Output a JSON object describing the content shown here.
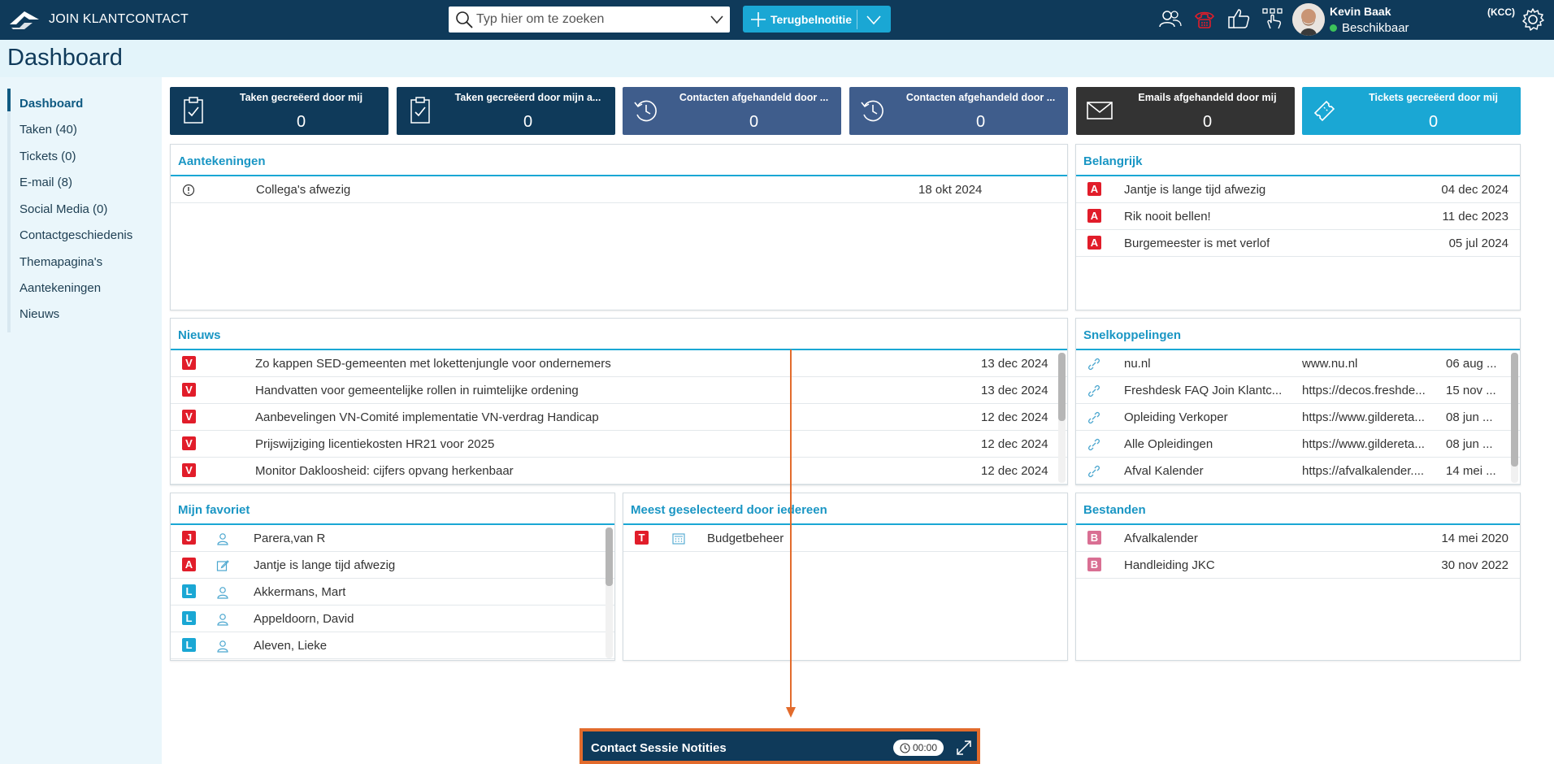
{
  "header": {
    "logo_text": "JOIN KLANTCONTACT",
    "search_placeholder": "Typ hier om te zoeken",
    "note_button": "Terugbelnotitie",
    "user_name": "Kevin Baak",
    "user_status": "Beschikbaar",
    "user_badge": "(KCC)",
    "icons": [
      "contacts-icon",
      "phone-icon",
      "thumbs-up-icon",
      "touch-icon"
    ],
    "colors": {
      "bar": "#0f3a5a",
      "accent": "#1aa7d4",
      "status_ok": "#3cc35a",
      "phone_red": "#e11d2a"
    }
  },
  "page": {
    "title": "Dashboard"
  },
  "sidebar": {
    "items": [
      {
        "label": "Dashboard",
        "active": true
      },
      {
        "label": "Taken (40)"
      },
      {
        "label": "Tickets (0)"
      },
      {
        "label": "E-mail (8)"
      },
      {
        "label": "Social Media (0)"
      },
      {
        "label": "Contactgeschiedenis"
      },
      {
        "label": "Themapagina's"
      },
      {
        "label": "Aantekeningen"
      },
      {
        "label": "Nieuws"
      }
    ]
  },
  "tiles": [
    {
      "label": "Taken gecreëerd door mij",
      "value": "0",
      "icon": "clipboard-check-icon",
      "color": "#0f3a5a"
    },
    {
      "label": "Taken gecreëerd door mijn a...",
      "value": "0",
      "icon": "clipboard-check-icon",
      "color": "#0f3a5a"
    },
    {
      "label": "Contacten afgehandeld door ...",
      "value": "0",
      "icon": "history-icon",
      "color": "#3f5d8c"
    },
    {
      "label": "Contacten afgehandeld door ...",
      "value": "0",
      "icon": "history-icon",
      "color": "#3f5d8c"
    },
    {
      "label": "Emails afgehandeld door mij",
      "value": "0",
      "icon": "envelope-icon",
      "color": "#333333"
    },
    {
      "label": "Tickets gecreëerd door mij",
      "value": "0",
      "icon": "ticket-icon",
      "color": "#1aa7d4"
    }
  ],
  "aantekeningen": {
    "title": "Aantekeningen",
    "rows": [
      {
        "icon": "info-icon",
        "text": "Collega's afwezig",
        "date": "18 okt 2024"
      }
    ]
  },
  "belangrijk": {
    "title": "Belangrijk",
    "rows": [
      {
        "badge": "A",
        "text": "Jantje is lange tijd afwezig",
        "date": "04 dec 2024"
      },
      {
        "badge": "A",
        "text": "Rik nooit bellen!",
        "date": "11 dec 2023"
      },
      {
        "badge": "A",
        "text": "Burgemeester is met verlof",
        "date": "05 jul 2024"
      }
    ]
  },
  "nieuws": {
    "title": "Nieuws",
    "rows": [
      {
        "badge": "V",
        "text": "Zo kappen SED-gemeenten met lokettenjungle voor ondernemers",
        "date": "13 dec 2024"
      },
      {
        "badge": "V",
        "text": "Handvatten voor gemeentelijke rollen in ruimtelijke ordening",
        "date": "13 dec 2024"
      },
      {
        "badge": "V",
        "text": "Aanbevelingen VN-Comité implementatie VN-verdrag Handicap",
        "date": "12 dec 2024"
      },
      {
        "badge": "V",
        "text": "Prijswijziging licentiekosten HR21 voor 2025",
        "date": "12 dec 2024"
      },
      {
        "badge": "V",
        "text": "Monitor Dakloosheid: cijfers opvang herkenbaar",
        "date": "12 dec 2024"
      }
    ]
  },
  "snelkoppelingen": {
    "title": "Snelkoppelingen",
    "rows": [
      {
        "name": "nu.nl",
        "url": "www.nu.nl",
        "date": "06 aug ..."
      },
      {
        "name": "Freshdesk FAQ Join Klantc...",
        "url": "https://decos.freshde...",
        "date": "15 nov ..."
      },
      {
        "name": "Opleiding Verkoper",
        "url": "https://www.gildereta...",
        "date": "08 jun ..."
      },
      {
        "name": "Alle Opleidingen",
        "url": "https://www.gildereta...",
        "date": "08 jun ..."
      },
      {
        "name": "Afval Kalender",
        "url": "https://afvalkalender....",
        "date": "14 mei ..."
      }
    ]
  },
  "favoriet": {
    "title": "Mijn favoriet",
    "rows": [
      {
        "badge": "J",
        "badge_color": "red",
        "icon": "person-icon",
        "text": "Parera,van R"
      },
      {
        "badge": "A",
        "badge_color": "red",
        "icon": "edit-note-icon",
        "text": "Jantje is lange tijd afwezig"
      },
      {
        "badge": "L",
        "badge_color": "blue",
        "icon": "person-icon",
        "text": "Akkermans, Mart"
      },
      {
        "badge": "L",
        "badge_color": "blue",
        "icon": "person-icon",
        "text": "Appeldoorn, David"
      },
      {
        "badge": "L",
        "badge_color": "blue",
        "icon": "person-icon",
        "text": "Aleven, Lieke"
      }
    ]
  },
  "meest": {
    "title": "Meest geselecteerd door iedereen",
    "rows": [
      {
        "badge": "T",
        "icon": "calculator-icon",
        "text": "Budgetbeheer"
      }
    ]
  },
  "bestanden": {
    "title": "Bestanden",
    "rows": [
      {
        "badge": "B",
        "text": "Afvalkalender",
        "date": "14 mei 2020"
      },
      {
        "badge": "B",
        "text": "Handleiding JKC",
        "date": "30 nov 2022"
      }
    ]
  },
  "session": {
    "title": "Contact Sessie Notities",
    "timer": "00:00",
    "highlight_color": "#e26b2c"
  }
}
